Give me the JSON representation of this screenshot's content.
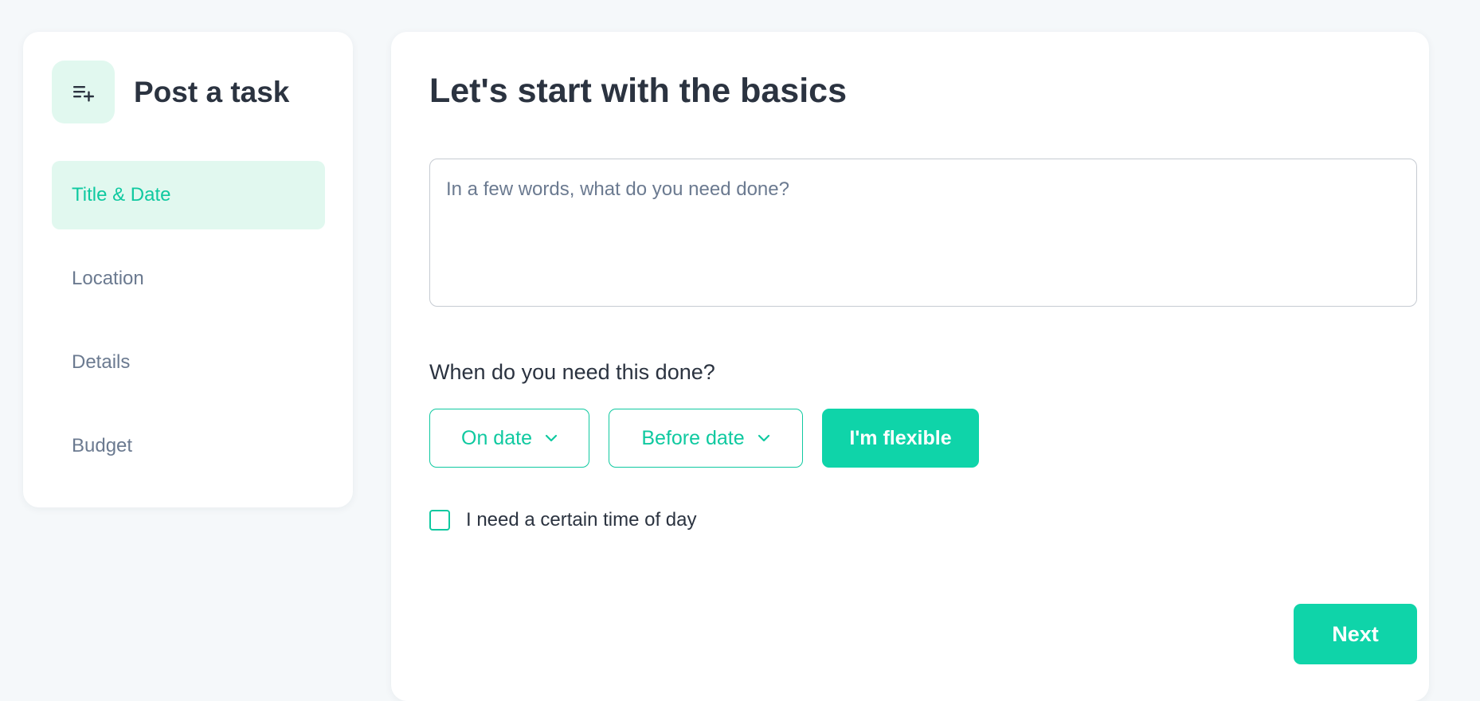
{
  "sidebar": {
    "title": "Post a task",
    "icon": "add-to-list-icon",
    "items": [
      {
        "label": "Title & Date",
        "active": true
      },
      {
        "label": "Location",
        "active": false
      },
      {
        "label": "Details",
        "active": false
      },
      {
        "label": "Budget",
        "active": false
      }
    ]
  },
  "main": {
    "title": "Let's start with the basics",
    "task_input": {
      "value": "",
      "placeholder": "In a few words, what do you need done?"
    },
    "when_question": "When do you need this done?",
    "date_options": [
      {
        "label": "On date",
        "icon": "chevron-down-icon",
        "selected": false
      },
      {
        "label": "Before date",
        "icon": "chevron-down-icon",
        "selected": false
      },
      {
        "label": "I'm flexible",
        "selected": true
      }
    ],
    "time_of_day_checkbox": {
      "label": "I need a certain time of day",
      "checked": false
    },
    "next_label": "Next"
  },
  "colors": {
    "accent": "#0fd4a9",
    "accent_text": "#0fc9a0",
    "accent_light": "#e1f8ef",
    "text_dark": "#2b3340",
    "text_muted": "#6b7a90",
    "background": "#f5f8fa"
  }
}
